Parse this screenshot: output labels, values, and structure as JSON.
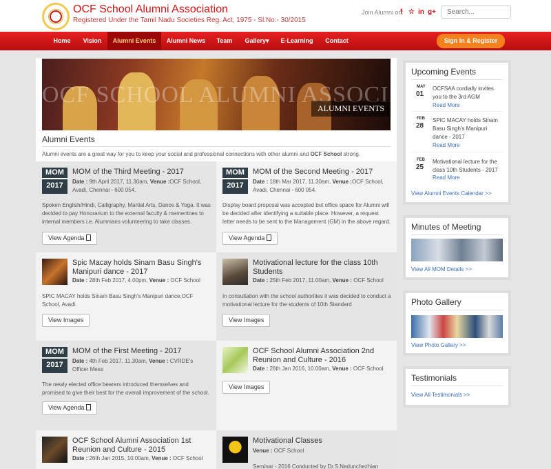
{
  "header": {
    "title": "OCF School Alumni Association",
    "subtitle": "Registered Under the Tamil Nadu Societies Reg. Act, 1975 - Sl.No:- 30/2015",
    "join_label": "Join Alumni on:",
    "social": [
      "f",
      "☆",
      "in",
      "g+"
    ],
    "search_placeholder": "Search..."
  },
  "nav": {
    "items": [
      "Home",
      "Vision",
      "Alumni Events",
      "Alumni News",
      "Team",
      "Gallery▾",
      "E-Learning",
      "Contact"
    ],
    "active": "Alumni Events",
    "signin": "Sign In & Register"
  },
  "banner": {
    "ghost_text": "OCF SCHOOL ALUMNI ASSOCIA",
    "tag": "ALUMNI EVENTS"
  },
  "page": {
    "heading": "Alumni Events",
    "intro_pre": "Alumni events are a great way for you to keep your social and professional connections with other alumni and ",
    "intro_bold": "OCF School",
    "intro_post": " strong."
  },
  "labels": {
    "date": "Date :",
    "venue": "Venue :"
  },
  "events": [
    {
      "badge_top": "MOM",
      "badge_year": "2017",
      "title": "MOM of the Third Meeting - 2017",
      "date": "9th April 2017, 11.30am,",
      "venue": "OCF School, Avadi, Chennai - 600 054.",
      "body": "Spoken English/Hindi, Calligraphy, Martial Arts, Dance & Yoga. It was decided to pay Honorarium to the external faculty & mementoes to internal members i.e. Alumnians volunteering to take classes.",
      "button": "View Agenda"
    },
    {
      "badge_top": "MOM",
      "badge_year": "2017",
      "title": "MOM of the Second Meeting - 2017",
      "date": "18th Mar 2017, 11.30am,",
      "venue": "OCF School, Avadi, Chennai - 600 054.",
      "body": "Display board proposal was accepted but office space for Alumni will be decided after identifying a suitable place. However, a request letter needs to be sent to the Management (GM) in the above regard.",
      "button": "View Agenda"
    },
    {
      "title": "Spic Macay holds Sinam Basu Singh's Manipuri dance - 2017",
      "date": "28th Feb 2017, 4.00pm,",
      "venue": "OCF School",
      "body": "SPIC MACAY holds Sinam Basu Singh's Manipuri dance,OCF School, Avadi.",
      "button": "View Images"
    },
    {
      "title": "Motivational lecture for the class 10th Students",
      "date": "25th Feb 2017, 11.00am,",
      "venue": "OCF School",
      "body": "In consultation with the school authorities it was decided to conduct a motivational lecture for the students of 10th Standard",
      "button": "View Images"
    },
    {
      "badge_top": "MOM",
      "badge_year": "2017",
      "title": "MOM of the First Meeting - 2017",
      "date": "4th Feb 2017, 11.30am,",
      "venue": "CVRDE's Officer Mess",
      "body": "The newly elected office bearers introduced themselves and promised to give their best for the overall improvement of the school.",
      "button": "View Agenda"
    },
    {
      "title": "OCF School Alumni Association 2nd Reunion and Culture - 2016",
      "date": "26th Jan 2016, 10.00am,",
      "venue": "OCF School",
      "button": "View Images"
    },
    {
      "title": "OCF School Alumni Association 1st Reunion and Culture - 2015",
      "date": "26th Jan 2015, 10.00am,",
      "venue": "OCF School"
    },
    {
      "title": "Motivational Classes",
      "venue": "OCF School",
      "body": "Seminar - 2016 Conducted by Dr.S.Nedunchezhian"
    }
  ],
  "sidebar": {
    "upcoming": {
      "title": "Upcoming Events",
      "items": [
        {
          "month": "MAY",
          "day": "01",
          "text": "OCFSAA cordially invites you to the 3rd AGM",
          "more": "Read More"
        },
        {
          "month": "FEB",
          "day": "28",
          "text": "SPIC MACAY holds Sinam Basu Singh's Manipuri dance - 2017",
          "more": "Read More"
        },
        {
          "month": "FEB",
          "day": "25",
          "text": "Motivational lecture for the class 10th Students - 2017",
          "more": "Read More"
        }
      ],
      "link": "View Alumni Events Calendar >>"
    },
    "minutes": {
      "title": "Minutes of Meeting",
      "link": "View All MOM Details >>"
    },
    "gallery": {
      "title": "Photo Gallery",
      "link": "View Photo Gallery >>"
    },
    "testimonials": {
      "title": "Testimonials",
      "link": "View All Testimonials >>"
    }
  }
}
